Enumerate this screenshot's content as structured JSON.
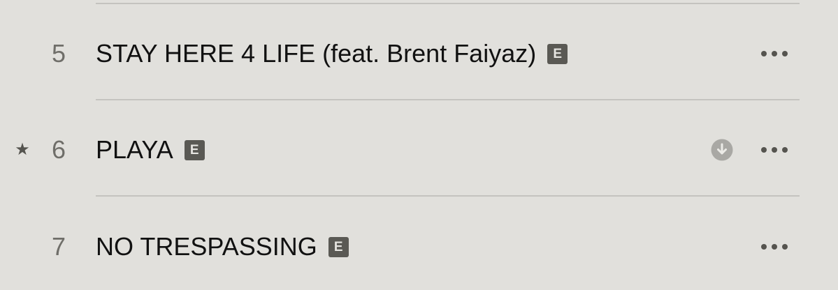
{
  "tracks": [
    {
      "number": "5",
      "title": "STAY HERE 4 LIFE (feat. Brent Faiyaz)",
      "explicit_label": "E"
    },
    {
      "number": "6",
      "title": "PLAYA",
      "explicit_label": "E",
      "starred": true,
      "star_symbol": "★",
      "downloadable": true
    },
    {
      "number": "7",
      "title": "NO TRESPASSING",
      "explicit_label": "E"
    }
  ],
  "icons": {
    "star": "star-icon",
    "explicit": "explicit-badge",
    "download": "download-icon",
    "more": "more-options-icon"
  },
  "colors": {
    "background": "#e1e0dc",
    "divider": "#c4c3bf",
    "title": "#111111",
    "number": "#6f6e69",
    "badge": "#5a5954",
    "download_circle": "#a9a8a4",
    "more_dots": "#55544f"
  }
}
